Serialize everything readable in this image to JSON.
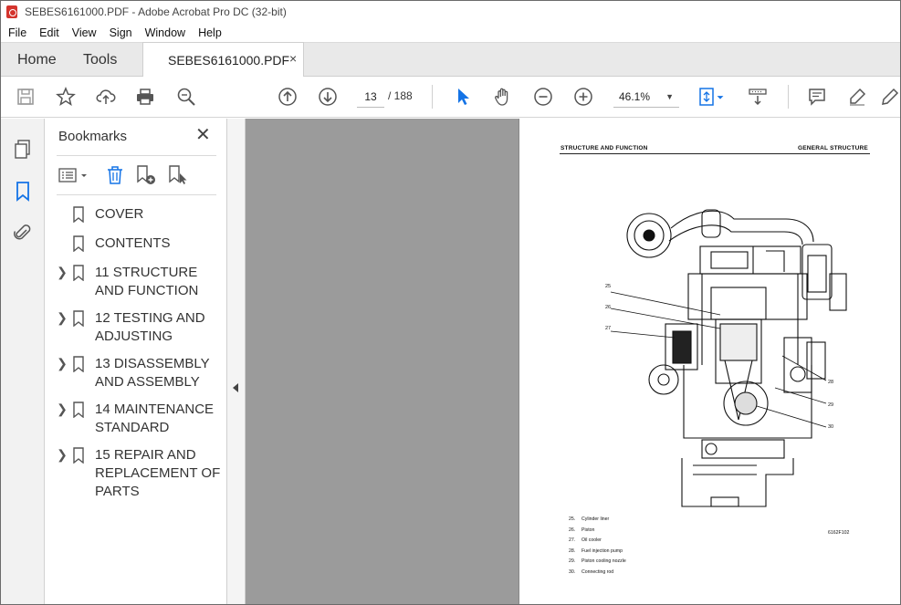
{
  "window": {
    "title": "SEBES6161000.PDF - Adobe Acrobat Pro DC (32-bit)"
  },
  "menu": [
    "File",
    "Edit",
    "View",
    "Sign",
    "Window",
    "Help"
  ],
  "tabs": {
    "home": "Home",
    "tools": "Tools",
    "document": "SEBES6161000.PDF",
    "close_glyph": "×"
  },
  "toolbar": {
    "page_current": "13",
    "page_total": "/ 188",
    "zoom": "46.1%",
    "icons": [
      "save-icon",
      "star-icon",
      "upload-icon",
      "print-icon",
      "search-zoom-icon",
      "previous-page-icon",
      "next-page-icon",
      "select-arrow-icon",
      "hand-icon",
      "zoom-out-icon",
      "zoom-in-icon",
      "fit-page-icon",
      "scroll-mode-icon",
      "comment-icon",
      "highlight-icon",
      "draw-icon"
    ]
  },
  "rail": {
    "icons": [
      "page-thumbnails-icon",
      "bookmarks-icon",
      "attachments-icon"
    ]
  },
  "bookmarks": {
    "title": "Bookmarks",
    "close_glyph": "✕",
    "items": [
      {
        "label": "COVER",
        "expandable": false
      },
      {
        "label": "CONTENTS",
        "expandable": false
      },
      {
        "label": "11 STRUCTURE AND FUNCTION",
        "expandable": true
      },
      {
        "label": "12 TESTING AND ADJUSTING",
        "expandable": true
      },
      {
        "label": "13 DISASSEMBLY AND ASSEMBLY",
        "expandable": true
      },
      {
        "label": "14 MAINTENANCE STANDARD",
        "expandable": true
      },
      {
        "label": "15 REPAIR AND REPLACEMENT OF PARTS",
        "expandable": true
      }
    ]
  },
  "page": {
    "header_left": "STRUCTURE AND FUNCTION",
    "header_right": "GENERAL STRUCTURE",
    "callouts": [
      "25",
      "26",
      "27",
      "28",
      "29",
      "30"
    ],
    "legend": [
      {
        "num": "25.",
        "text": "Cylinder liner"
      },
      {
        "num": "26.",
        "text": "Piston"
      },
      {
        "num": "27.",
        "text": "Oil cooler"
      },
      {
        "num": "28.",
        "text": "Fuel injection pump"
      },
      {
        "num": "29.",
        "text": "Piston cooling nozzle"
      },
      {
        "num": "30.",
        "text": "Connecting rod"
      }
    ],
    "figure_code": "6162F102"
  },
  "colors": {
    "accent_blue": "#1473e6",
    "pdf_red": "#d4342d",
    "viewer_gray": "#9b9b9b"
  }
}
